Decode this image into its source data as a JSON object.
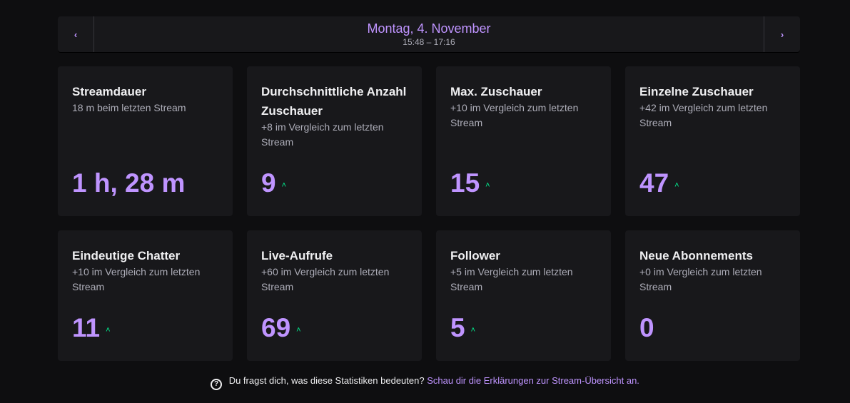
{
  "datebar": {
    "prev_icon": "chevron-left-icon",
    "prev_glyph": "‹",
    "next_icon": "chevron-right-icon",
    "next_glyph": "›",
    "date": "Montag, 4. November",
    "time_range": "15:48 – 17:16"
  },
  "colors": {
    "background": "#0e0e10",
    "card": "#18181b",
    "accent": "#bf94ff",
    "up": "#00f593",
    "muted": "#adadb8"
  },
  "cards": [
    {
      "title": "Streamdauer",
      "sub": "18 m beim letzten Stream",
      "value": "1 h, 28 m",
      "trend": ""
    },
    {
      "title": "Durchschnittliche Anzahl Zuschauer",
      "sub": "+8 im Vergleich zum letzten Stream",
      "value": "9",
      "trend": "˄"
    },
    {
      "title": "Max. Zuschauer",
      "sub": "+10 im Vergleich zum letzten Stream",
      "value": "15",
      "trend": "˄"
    },
    {
      "title": "Einzelne Zuschauer",
      "sub": "+42 im Vergleich zum letzten Stream",
      "value": "47",
      "trend": "˄"
    },
    {
      "title": "Eindeutige Chatter",
      "sub": "+10 im Vergleich zum letzten Stream",
      "value": "11",
      "trend": "˄"
    },
    {
      "title": "Live-Aufrufe",
      "sub": "+60 im Vergleich zum letzten Stream",
      "value": "69",
      "trend": "˄"
    },
    {
      "title": "Follower",
      "sub": "+5 im Vergleich zum letzten Stream",
      "value": "5",
      "trend": "˄"
    },
    {
      "title": "Neue Abonnements",
      "sub": "+0 im Vergleich zum letzten Stream",
      "value": "0",
      "trend": ""
    }
  ],
  "footer": {
    "help_icon": "question-circle-icon",
    "help_glyph": "?",
    "question": "Du fragst dich, was diese Statistiken bedeuten?",
    "link": "Schau dir die Erklärungen zur Stream-Übersicht an."
  }
}
